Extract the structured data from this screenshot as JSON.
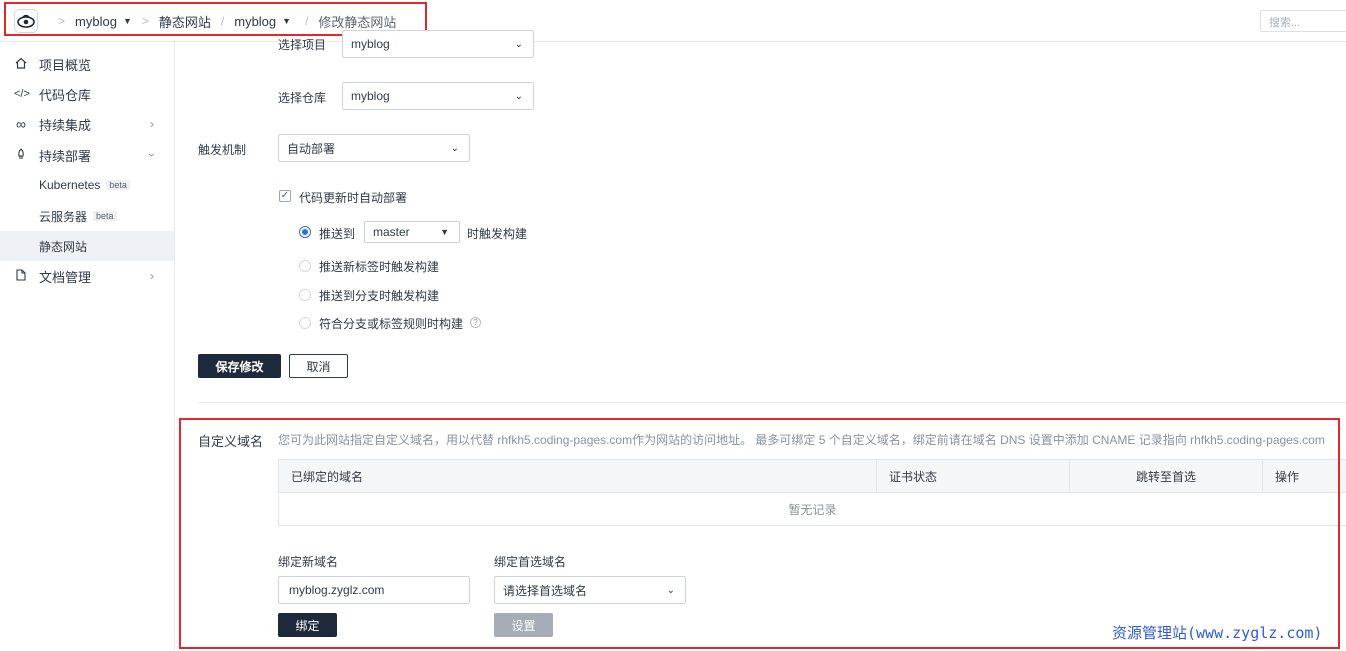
{
  "topbar": {
    "crumbs": [
      "myblog",
      "静态网站",
      "myblog",
      "修改静态网站"
    ],
    "search_placeholder": "搜索..."
  },
  "sidebar": {
    "items": [
      {
        "icon": "home-icon",
        "label": "项目概览"
      },
      {
        "icon": "code-icon",
        "label": "代码仓库"
      },
      {
        "icon": "infinity-icon",
        "label": "持续集成"
      },
      {
        "icon": "rocket-icon",
        "label": "持续部署"
      },
      {
        "label": "Kubernetes",
        "badge": "beta"
      },
      {
        "label": "云服务器",
        "badge": "beta"
      },
      {
        "label": "静态网站"
      },
      {
        "icon": "document-icon",
        "label": "文档管理"
      }
    ]
  },
  "form": {
    "project_label": "选择项目",
    "project_value": "myblog",
    "repo_label": "选择仓库",
    "repo_value": "myblog",
    "trigger_label": "触发机制",
    "trigger_value": "自动部署",
    "auto_deploy_checkbox": "代码更新时自动部署",
    "push_to_label": "推送到",
    "branch_value": "master",
    "push_suffix": "时触发构建",
    "option_tag": "推送新标签时触发构建",
    "option_branch": "推送到分支时触发构建",
    "option_rule": "符合分支或标签规则时构建",
    "save_button": "保存修改",
    "cancel_button": "取消"
  },
  "domain": {
    "section_label": "自定义域名",
    "description": "您可为此网站指定自定义域名，用以代替 rhfkh5.coding-pages.com作为网站的访问地址。 最多可绑定 5 个自定义域名，绑定前请在域名 DNS 设置中添加 CNAME 记录指向 rhfkh5.coding-pages.com",
    "table_headers": [
      "已绑定的域名",
      "证书状态",
      "跳转至首选",
      "操作"
    ],
    "empty_text": "暂无记录",
    "bind_new_label": "绑定新域名",
    "bind_new_value": "myblog.zyglz.com",
    "preferred_label": "绑定首选域名",
    "preferred_placeholder": "请选择首选域名",
    "bind_button": "绑定",
    "set_button": "设置"
  },
  "watermark": "资源管理站(www.zyglz.com)",
  "colors": {
    "highlight": "#e02a2a",
    "primary_dark": "#1e2a3c",
    "accent": "#2e6be6"
  }
}
